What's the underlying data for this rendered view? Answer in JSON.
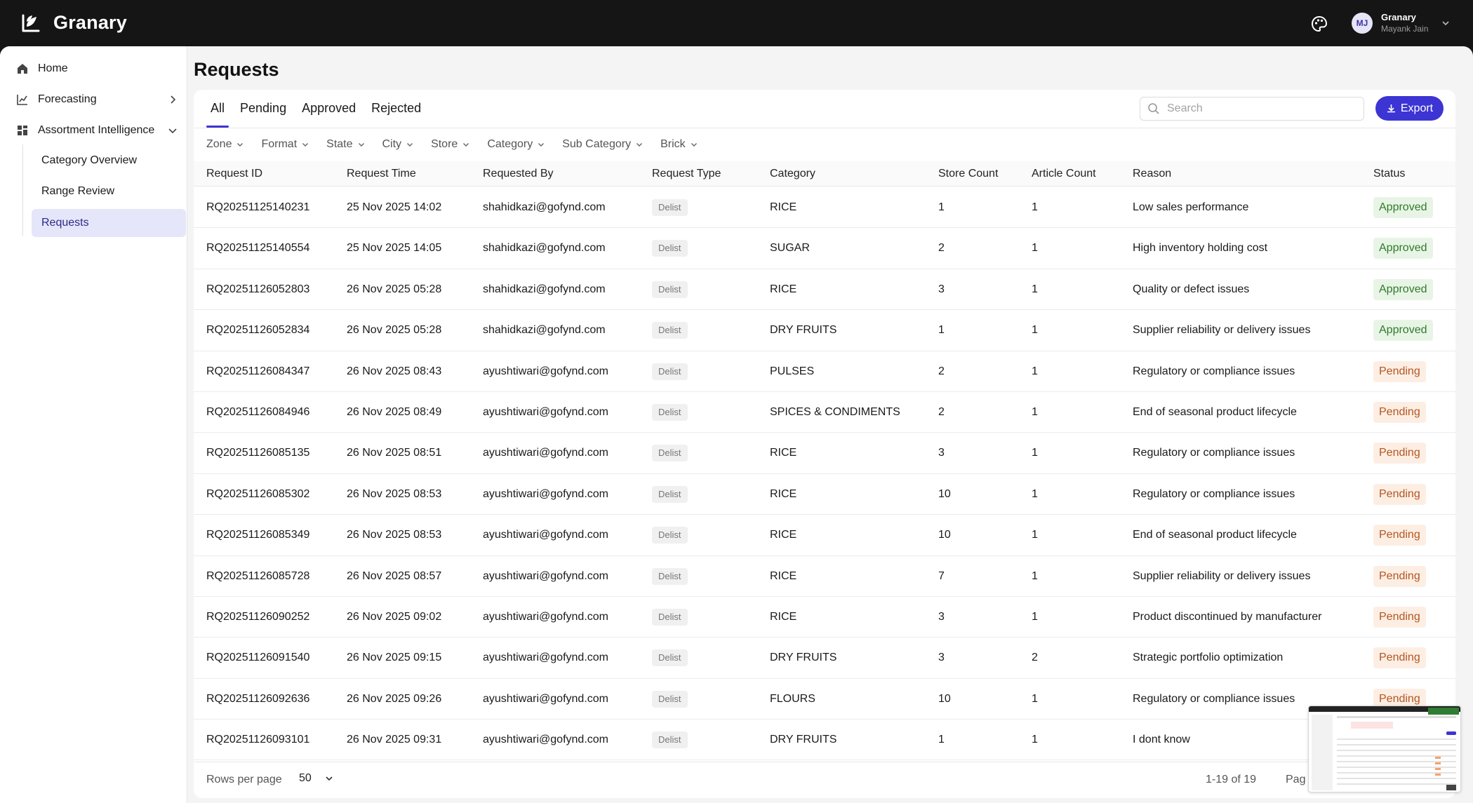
{
  "app": {
    "brand": "Granary"
  },
  "user": {
    "initials": "MJ",
    "org": "Granary",
    "name": "Mayank Jain"
  },
  "sidebar": {
    "home": "Home",
    "forecasting": "Forecasting",
    "assortment": "Assortment Intelligence",
    "sub": [
      "Category Overview",
      "Range Review",
      "Requests"
    ]
  },
  "page": {
    "title": "Requests"
  },
  "tabs": [
    "All",
    "Pending",
    "Approved",
    "Rejected"
  ],
  "search": {
    "placeholder": "Search"
  },
  "export_label": "Export",
  "filters": [
    "Zone",
    "Format",
    "State",
    "City",
    "Store",
    "Category",
    "Sub Category",
    "Brick"
  ],
  "columns": [
    "Request ID",
    "Request Time",
    "Requested By",
    "Request Type",
    "Category",
    "Store Count",
    "Article Count",
    "Reason",
    "Status"
  ],
  "rows": [
    [
      "RQ20251125140231",
      "25 Nov 2025 14:02",
      "shahidkazi@gofynd.com",
      "Delist",
      "RICE",
      "1",
      "1",
      "Low sales performance",
      "Approved"
    ],
    [
      "RQ20251125140554",
      "25 Nov 2025 14:05",
      "shahidkazi@gofynd.com",
      "Delist",
      "SUGAR",
      "2",
      "1",
      "High inventory holding cost",
      "Approved"
    ],
    [
      "RQ20251126052803",
      "26 Nov 2025 05:28",
      "shahidkazi@gofynd.com",
      "Delist",
      "RICE",
      "3",
      "1",
      "Quality or defect issues",
      "Approved"
    ],
    [
      "RQ20251126052834",
      "26 Nov 2025 05:28",
      "shahidkazi@gofynd.com",
      "Delist",
      "DRY FRUITS",
      "1",
      "1",
      "Supplier reliability or delivery issues",
      "Approved"
    ],
    [
      "RQ20251126084347",
      "26 Nov 2025 08:43",
      "ayushtiwari@gofynd.com",
      "Delist",
      "PULSES",
      "2",
      "1",
      "Regulatory or compliance issues",
      "Pending"
    ],
    [
      "RQ20251126084946",
      "26 Nov 2025 08:49",
      "ayushtiwari@gofynd.com",
      "Delist",
      "SPICES & CONDIMENTS",
      "2",
      "1",
      "End of seasonal product lifecycle",
      "Pending"
    ],
    [
      "RQ20251126085135",
      "26 Nov 2025 08:51",
      "ayushtiwari@gofynd.com",
      "Delist",
      "RICE",
      "3",
      "1",
      "Regulatory or compliance issues",
      "Pending"
    ],
    [
      "RQ20251126085302",
      "26 Nov 2025 08:53",
      "ayushtiwari@gofynd.com",
      "Delist",
      "RICE",
      "10",
      "1",
      "Regulatory or compliance issues",
      "Pending"
    ],
    [
      "RQ20251126085349",
      "26 Nov 2025 08:53",
      "ayushtiwari@gofynd.com",
      "Delist",
      "RICE",
      "10",
      "1",
      "End of seasonal product lifecycle",
      "Pending"
    ],
    [
      "RQ20251126085728",
      "26 Nov 2025 08:57",
      "ayushtiwari@gofynd.com",
      "Delist",
      "RICE",
      "7",
      "1",
      "Supplier reliability or delivery issues",
      "Pending"
    ],
    [
      "RQ20251126090252",
      "26 Nov 2025 09:02",
      "ayushtiwari@gofynd.com",
      "Delist",
      "RICE",
      "3",
      "1",
      "Product discontinued by manufacturer",
      "Pending"
    ],
    [
      "RQ20251126091540",
      "26 Nov 2025 09:15",
      "ayushtiwari@gofynd.com",
      "Delist",
      "DRY FRUITS",
      "3",
      "2",
      "Strategic portfolio optimization",
      "Pending"
    ],
    [
      "RQ20251126092636",
      "26 Nov 2025 09:26",
      "ayushtiwari@gofynd.com",
      "Delist",
      "FLOURS",
      "10",
      "1",
      "Regulatory or compliance issues",
      "Pending"
    ],
    [
      "RQ20251126093101",
      "26 Nov 2025 09:31",
      "ayushtiwari@gofynd.com",
      "Delist",
      "DRY FRUITS",
      "1",
      "1",
      "I dont know",
      ""
    ]
  ],
  "pagination": {
    "rows_label": "Rows per page",
    "rows_value": "50",
    "range": "1-19 of 19",
    "page_label": "Pag"
  },
  "colors": {
    "accent": "#3d34d4",
    "topbar": "#151515",
    "approved": "#2f7a2a",
    "pending": "#b25621"
  }
}
